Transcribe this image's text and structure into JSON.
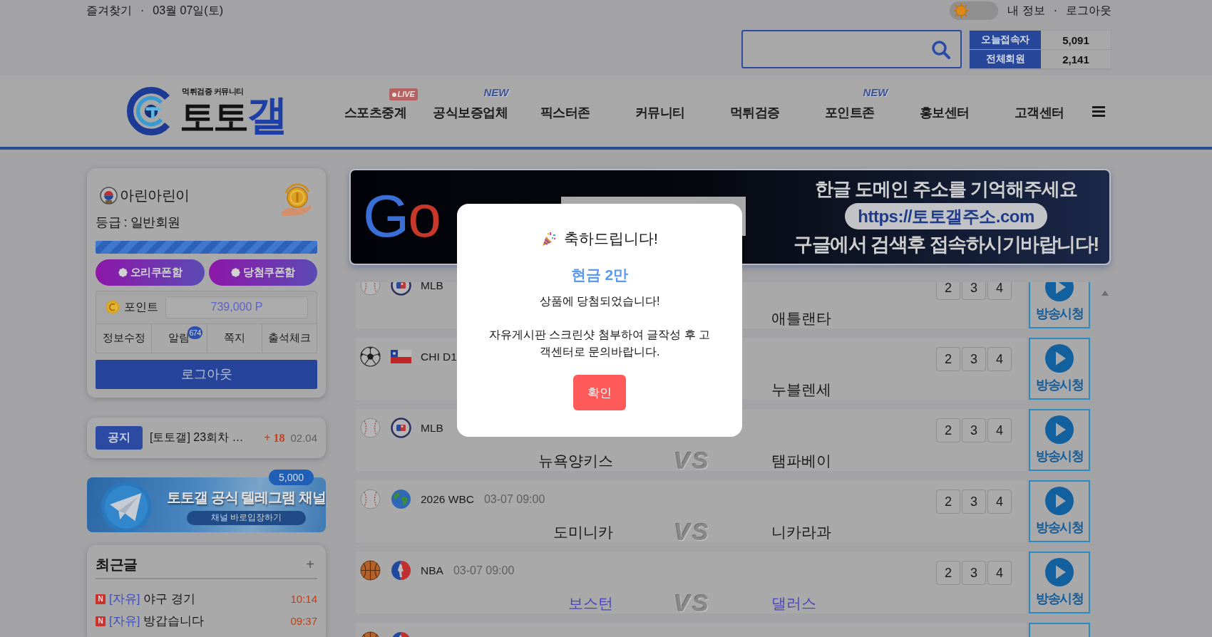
{
  "top_bar": {
    "favorites": "즐겨찾기",
    "separator": "·",
    "date": "03월 07일(토)",
    "dark_mode": false,
    "my_info": "내 정보",
    "separator_2": "·",
    "logout": "로그아웃"
  },
  "stats": [
    {
      "label": "오늘접속자",
      "value": "5,091"
    },
    {
      "label": "전체회원",
      "value": "2,141"
    }
  ],
  "logo": {
    "tagline": "먹튀검증 커뮤니티",
    "name": "토토",
    "name_accent": "갤"
  },
  "nav": [
    {
      "label": "스포츠중계",
      "badge": {
        "kind": "live",
        "text": "LIVE"
      }
    },
    {
      "label": "공식보증업체",
      "badge": {
        "kind": "new",
        "text": "NEW"
      }
    },
    {
      "label": "픽스터존"
    },
    {
      "label": "커뮤니티"
    },
    {
      "label": "먹튀검증"
    },
    {
      "label": "포인트존",
      "badge": {
        "kind": "new",
        "text": "NEW"
      }
    },
    {
      "label": "홍보센터"
    },
    {
      "label": "고객센터"
    }
  ],
  "profile": {
    "nickname": "아린아린이",
    "grade": "등급 : 일반회원",
    "exp_bar": {
      "level": 1
    },
    "coupons": [
      "오리쿠폰함",
      "당첨쿠폰함"
    ],
    "points_label": "포인트",
    "points": "739,000 P",
    "menu": [
      {
        "label": "정보수정"
      },
      {
        "label": "알림",
        "badge": "674"
      },
      {
        "label": "쪽지"
      },
      {
        "label": "출석체크"
      }
    ],
    "logout": "로그아웃"
  },
  "notice": {
    "tag": "공지",
    "title": "[토토갤] 23회차 …",
    "comments": "+ 18",
    "date": "02.04"
  },
  "telegram_banner": {
    "badge": "5,000",
    "title": "토토갤 공식 텔레그램 채널",
    "button": "채널 바로입장하기"
  },
  "recent_posts": {
    "title": "최근글",
    "more": "+",
    "items": [
      {
        "mark": "N",
        "category": "[자유]",
        "title": "야구 경기",
        "time": "10:14"
      },
      {
        "mark": "N",
        "category": "[자유]",
        "title": "방갑습니다",
        "time": "09:37"
      }
    ]
  },
  "domain_banner": {
    "logo_text": "Go",
    "headline": "한글 도메인 주소를 기억해주세요",
    "url": "https://토토갤주소.com",
    "footer": "구글에서 검색후 접속하시기바랍니다!"
  },
  "games": [
    {
      "sport_icon": {
        "kind": "baseball"
      },
      "league_icon": {
        "kind": "mlb"
      },
      "league": "MLB",
      "odds": [
        "2",
        "3",
        "4"
      ],
      "away": "애틀랜타",
      "color": "#161616",
      "broadcast_label": "방송시청"
    },
    {
      "sport_icon": {
        "kind": "soccer"
      },
      "league_icon": {
        "kind": "chile"
      },
      "league": "CHI D1",
      "odds": [
        "2",
        "3",
        "4"
      ],
      "away": "누블렌세",
      "color": "#161616",
      "broadcast_label": "방송시청"
    },
    {
      "sport_icon": {
        "kind": "baseball"
      },
      "league_icon": {
        "kind": "mlb"
      },
      "league": "MLB",
      "odds": [
        "2",
        "3",
        "4"
      ],
      "home": "뉴욕양키스",
      "vs": "VS",
      "away": "탬파베이",
      "color": "#161616",
      "broadcast_label": "방송시청"
    },
    {
      "sport_icon": {
        "kind": "baseball"
      },
      "league_icon": {
        "kind": "globe"
      },
      "league": "2026 WBC",
      "date": "03-07 09:00",
      "odds": [
        "2",
        "3",
        "4"
      ],
      "home": "도미니카",
      "vs": "VS",
      "away": "니카라과",
      "color": "#161616",
      "broadcast_label": "방송시청"
    },
    {
      "sport_icon": {
        "kind": "basketball"
      },
      "league_icon": {
        "kind": "nba"
      },
      "league": "NBA",
      "date": "03-07 09:00",
      "odds": [
        "2",
        "3",
        "4"
      ],
      "home": "보스턴",
      "vs": "VS",
      "away": "댈러스",
      "color": "#4c45b9",
      "broadcast_label": "방송시청"
    },
    {
      "sport_icon": {
        "kind": "basketball"
      },
      "league_icon": {
        "kind": "nba"
      }
    }
  ],
  "modal": {
    "title": "축하드립니다!",
    "prize": "현금 2만",
    "message": "상품에 당첨되었습니다!",
    "instructions": "자유게시판 스크린샷 첨부하여 글작성 후 고객센터로 문의바랍니다.",
    "confirm": "확인"
  }
}
